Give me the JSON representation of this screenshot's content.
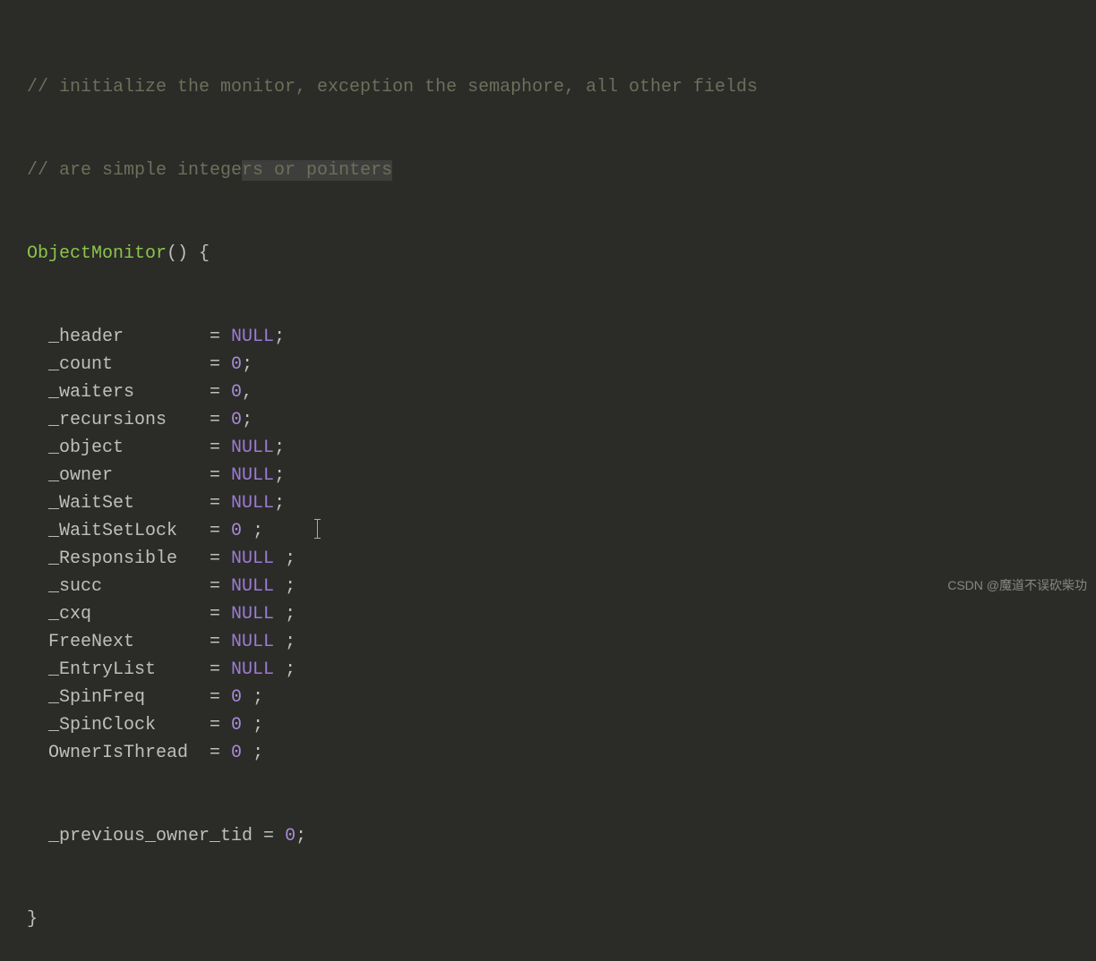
{
  "comments": [
    "// initialize the monitor, exception the semaphore, all other fields",
    "// are simple integers or pointers"
  ],
  "highlight_segment": "rs or pointers",
  "comment_line2_prefix": "// are simple intege",
  "func": {
    "name": "ObjectMonitor",
    "open": "() {",
    "close": "}"
  },
  "lines": [
    {
      "field": "_header",
      "eq": "= ",
      "val": "NULL",
      "tail": ";"
    },
    {
      "field": "_count",
      "eq": "= ",
      "val": "0",
      "tail": ";"
    },
    {
      "field": "_waiters",
      "eq": "= ",
      "val": "0",
      "tail": ","
    },
    {
      "field": "_recursions",
      "eq": "= ",
      "val": "0",
      "tail": ";"
    },
    {
      "field": "_object",
      "eq": "= ",
      "val": "NULL",
      "tail": ";"
    },
    {
      "field": "_owner",
      "eq": "= ",
      "val": "NULL",
      "tail": ";"
    },
    {
      "field": "_WaitSet",
      "eq": "= ",
      "val": "NULL",
      "tail": ";"
    },
    {
      "field": "_WaitSetLock",
      "eq": "= ",
      "val": "0",
      "tail": " ;",
      "cursor": true
    },
    {
      "field": "_Responsible",
      "eq": "= ",
      "val": "NULL",
      "tail": " ;"
    },
    {
      "field": "_succ",
      "eq": "= ",
      "val": "NULL",
      "tail": " ;"
    },
    {
      "field": "_cxq",
      "eq": "= ",
      "val": "NULL",
      "tail": " ;"
    },
    {
      "field": "FreeNext",
      "eq": "= ",
      "val": "NULL",
      "tail": " ;"
    },
    {
      "field": "_EntryList",
      "eq": "= ",
      "val": "NULL",
      "tail": " ;"
    },
    {
      "field": "_SpinFreq",
      "eq": "= ",
      "val": "0",
      "tail": " ;"
    },
    {
      "field": "_SpinClock",
      "eq": "= ",
      "val": "0",
      "tail": " ;"
    },
    {
      "field": "OwnerIsThread",
      "eq": "= ",
      "val": "0",
      "tail": " ;"
    }
  ],
  "last_line": {
    "field": "_previous_owner_tid",
    "eq": " = ",
    "val": "0",
    "tail": ";"
  },
  "field_col_width": 15,
  "watermark": "CSDN @魔道不误砍柴功"
}
